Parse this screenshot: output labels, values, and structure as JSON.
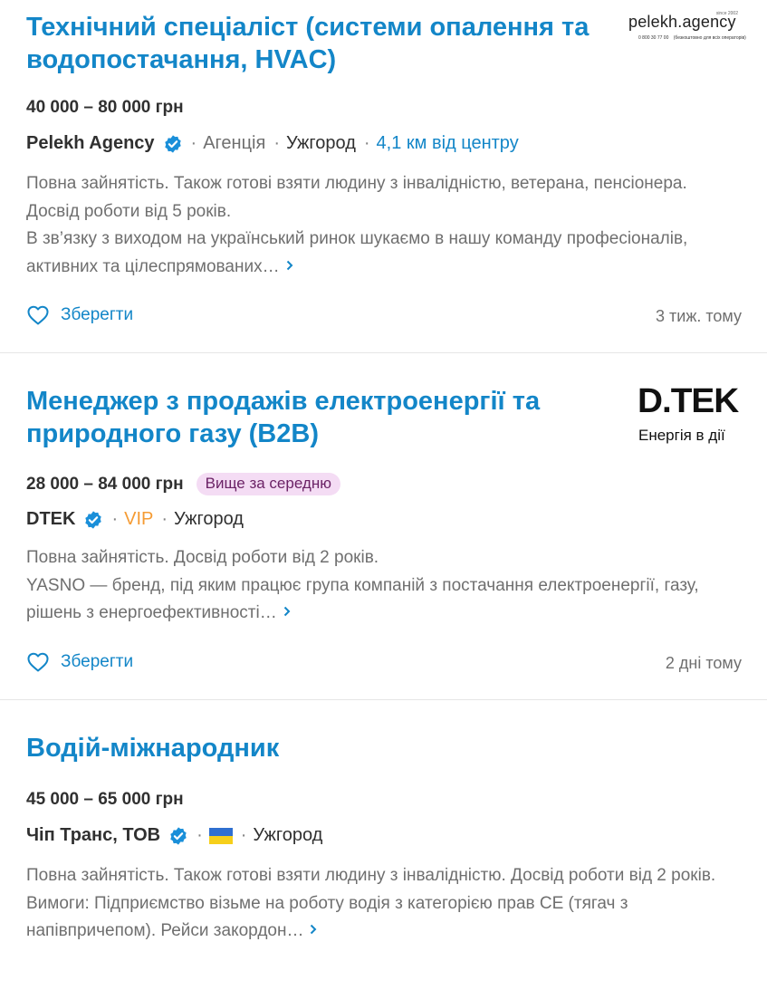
{
  "jobs": [
    {
      "title": "Технічний спеціаліст (системи опалення та водопостачання, HVAC)",
      "salary": "40 000 – 80 000 грн",
      "company": "Pelekh Agency",
      "type": "Агенція",
      "city": "Ужгород",
      "distance": "4,1 км від центру",
      "description": "Повна зайнятість. Також готові взяти людину з інвалідністю, ветерана, пенсіонера. Досвід роботи від 5 років.",
      "snippet": "В зв’язку з виходом на український ринок шукаємо в нашу команду професіоналів, активних та цілеспрямованих…",
      "save_label": "Зберегти",
      "posted": "3 тиж. тому",
      "logo": {
        "brand": "pelekh.agency",
        "since": "since 2002",
        "phone": "0 800 30 77 00",
        "phone_note": "(безкоштовно для всіх операторів)"
      }
    },
    {
      "title": "Менеджер з продажів електроенергії та природного газу (B2B)",
      "salary": "28 000 – 84 000 грн",
      "badge": "Вище за середню",
      "company": "DTEK",
      "vip": "VIP",
      "city": "Ужгород",
      "description": "Повна зайнятість. Досвід роботи від 2 років.",
      "snippet": "YASNO — бренд, під яким працює група компаній з постачання електроенергії, газу, рішень з енергоефективності…",
      "save_label": "Зберегти",
      "posted": "2 дні тому",
      "logo": {
        "brand": "D.TEK",
        "tagline": "Енергія в дії"
      }
    },
    {
      "title": "Водій-міжнародник",
      "salary": "45 000 – 65 000 грн",
      "company": "Чіп Транс, ТОВ",
      "city": "Ужгород",
      "description": "Повна зайнятість. Також готові взяти людину з інвалідністю. Досвід роботи від 2 років.",
      "snippet": "Вимоги: Підприємство візьме на роботу водія з категорією прав CE (тягач з напівпричепом). Рейси закордон…",
      "flag_icon": "ukraine-flag-icon"
    }
  ],
  "colors": {
    "accent": "#1386c8",
    "text": "#303030",
    "muted": "#6f6f6f",
    "vip": "#f59b33",
    "badge_bg": "#f4dcf4",
    "badge_text": "#6b2266"
  }
}
